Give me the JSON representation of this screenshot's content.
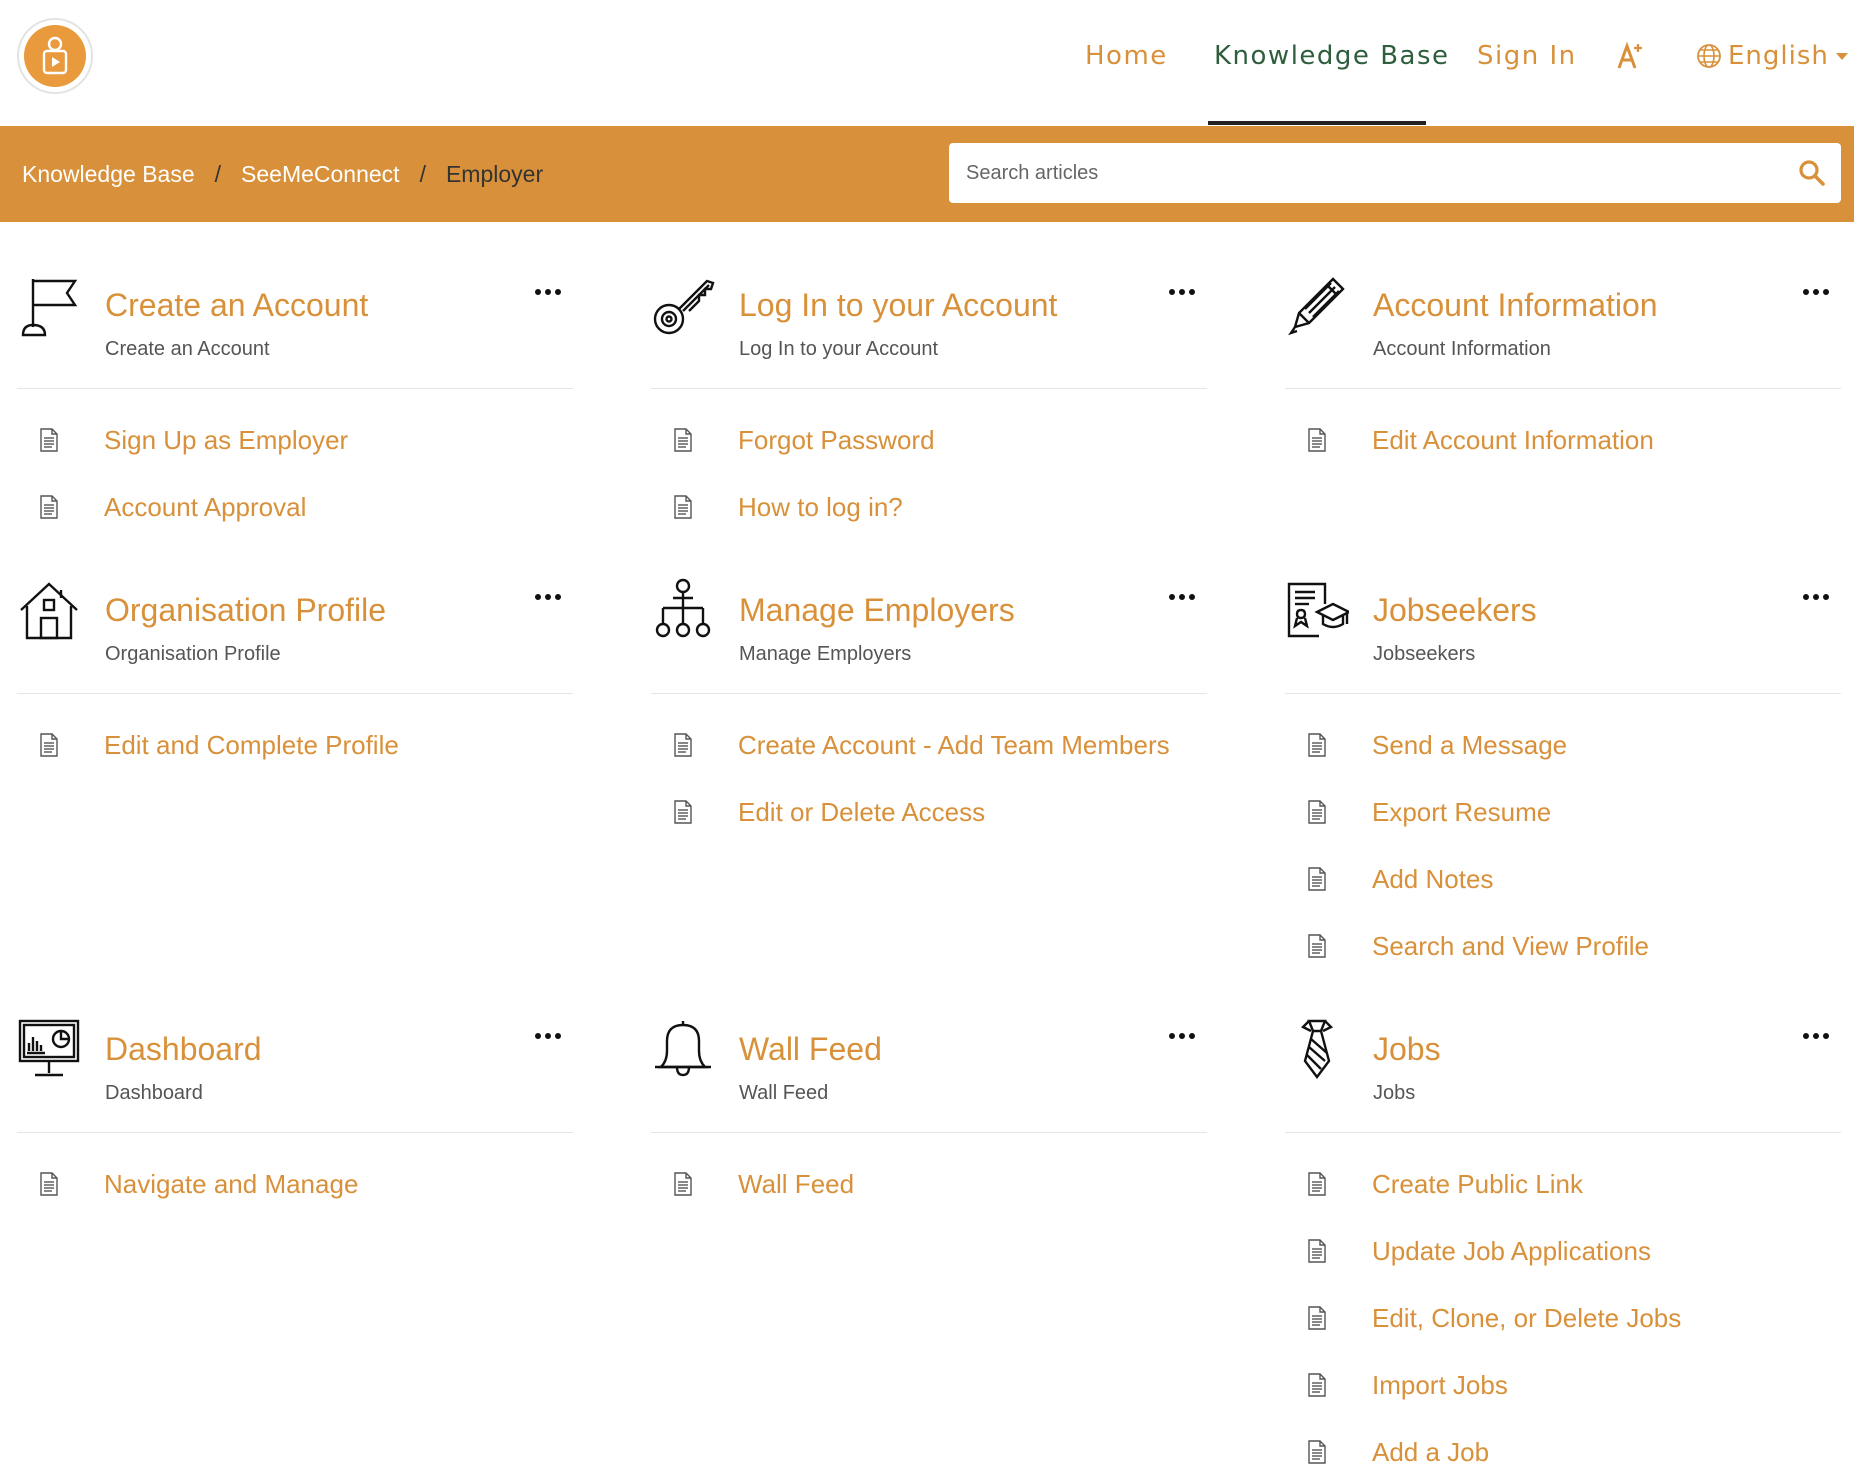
{
  "colors": {
    "accent": "#D8913A",
    "nav_active": "#2E5E3E",
    "bar": "#D8913A"
  },
  "header": {
    "nav": {
      "home": "Home",
      "knowledge_base": "Knowledge Base",
      "sign_in": "Sign In",
      "language": "English"
    }
  },
  "breadcrumb": {
    "items": [
      "Knowledge Base",
      "SeeMeConnect"
    ],
    "current": "Employer"
  },
  "search": {
    "placeholder": "Search articles"
  },
  "categories": [
    {
      "icon": "flag-icon",
      "title": "Create an Account",
      "subtitle": "Create an Account",
      "articles": [
        "Sign Up as Employer",
        "Account Approval"
      ]
    },
    {
      "icon": "key-icon",
      "title": "Log In to your Account",
      "subtitle": "Log In to your Account",
      "articles": [
        "Forgot Password",
        "How to log in?"
      ]
    },
    {
      "icon": "pencil-icon",
      "title": "Account Information",
      "subtitle": "Account Information",
      "articles": [
        "Edit Account Information"
      ]
    },
    {
      "icon": "house-icon",
      "title": "Organisation Profile",
      "subtitle": "Organisation Profile",
      "articles": [
        "Edit and Complete Profile"
      ]
    },
    {
      "icon": "org-chart-icon",
      "title": "Manage Employers",
      "subtitle": "Manage Employers",
      "articles": [
        "Create Account - Add Team Members",
        "Edit or Delete Access"
      ]
    },
    {
      "icon": "resume-graduate-icon",
      "title": "Jobseekers",
      "subtitle": "Jobseekers",
      "articles": [
        "Send a Message",
        "Export Resume",
        "Add Notes",
        "Search and View Profile"
      ]
    },
    {
      "icon": "monitor-chart-icon",
      "title": "Dashboard",
      "subtitle": "Dashboard",
      "articles": [
        "Navigate and Manage"
      ]
    },
    {
      "icon": "bell-icon",
      "title": "Wall Feed",
      "subtitle": "Wall Feed",
      "articles": [
        "Wall Feed"
      ]
    },
    {
      "icon": "necktie-icon",
      "title": "Jobs",
      "subtitle": "Jobs",
      "articles": [
        "Create Public Link",
        "Update Job Applications",
        "Edit, Clone, or Delete Jobs",
        "Import Jobs",
        "Add a Job"
      ]
    }
  ]
}
